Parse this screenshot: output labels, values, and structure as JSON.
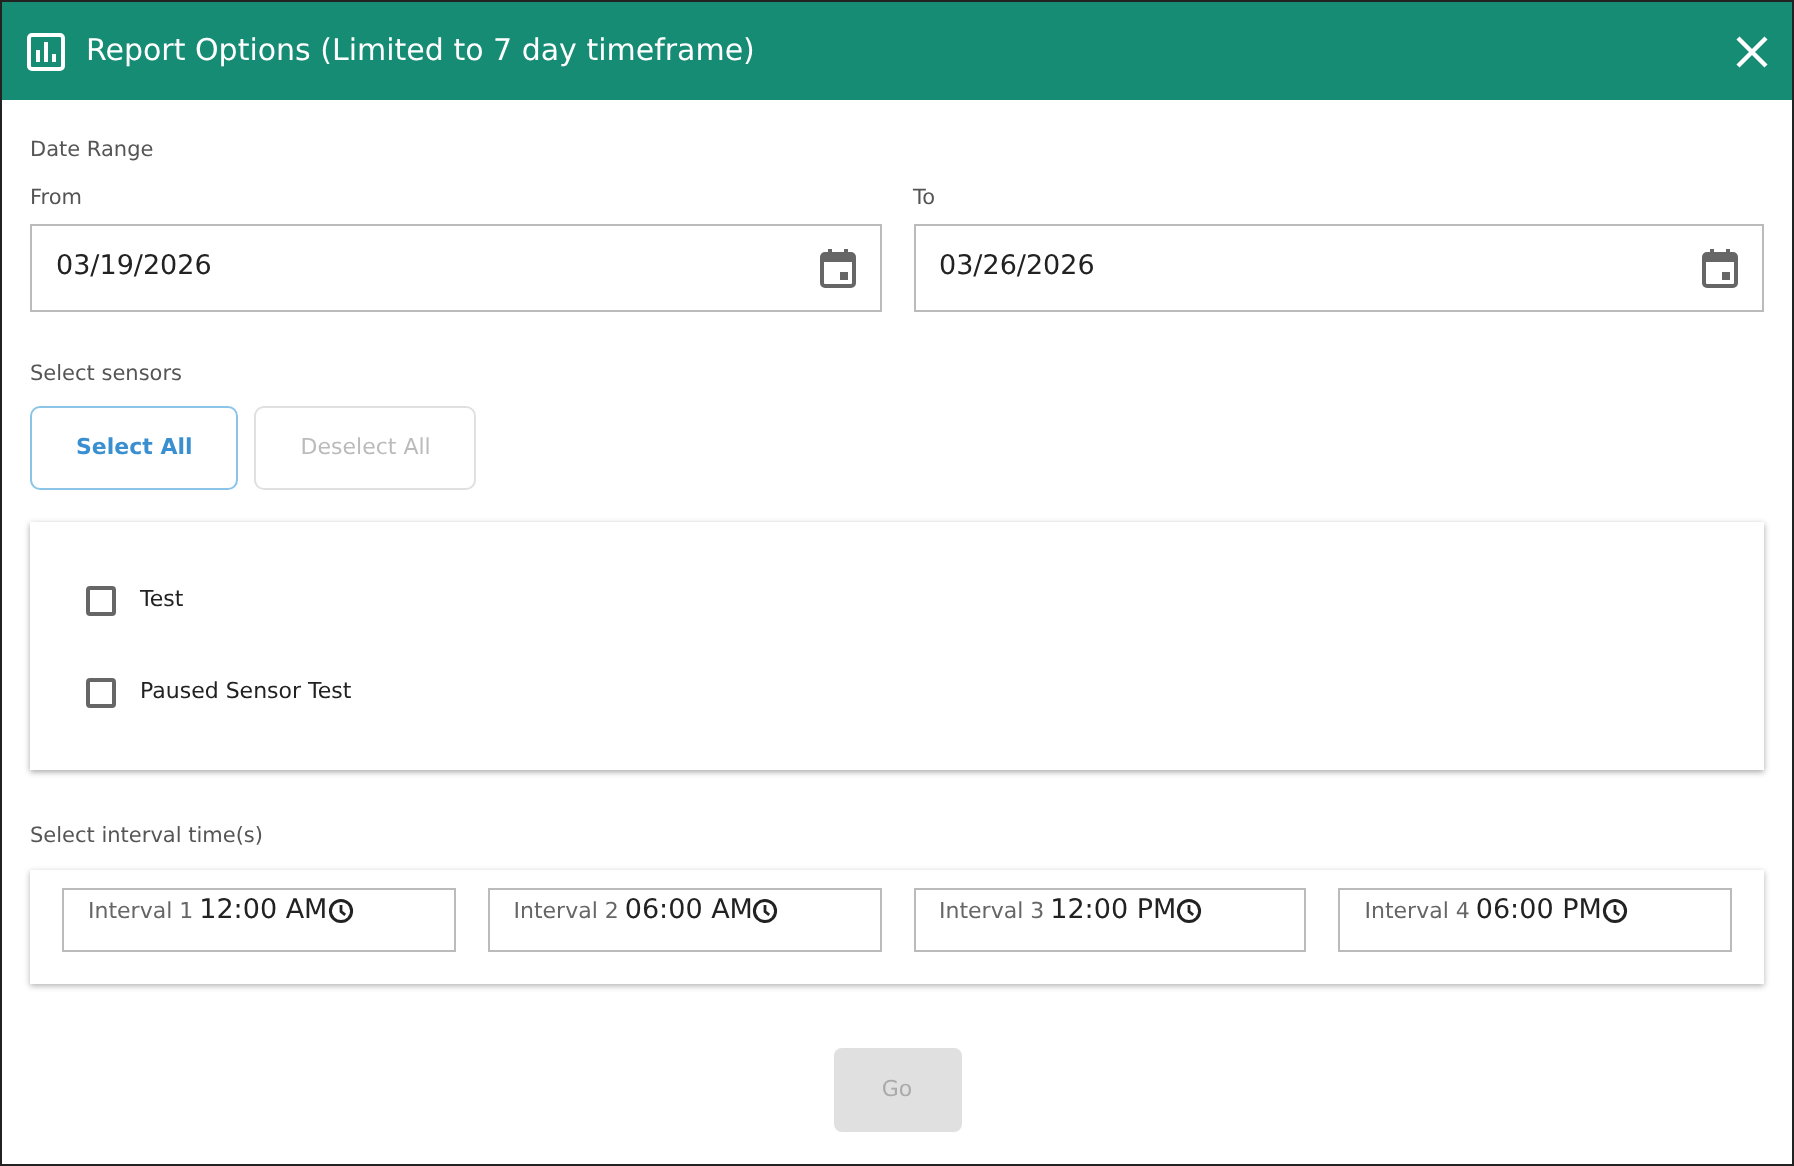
{
  "dialog": {
    "title": "Report Options (Limited to 7 day timeframe)"
  },
  "date_range": {
    "label": "Date Range",
    "fields": [
      {
        "label": "From",
        "value": "03/19/2026"
      },
      {
        "label": "To",
        "value": "03/26/2026"
      }
    ]
  },
  "sensors": {
    "label": "Select sensors",
    "buttons": [
      {
        "label": "Select All",
        "disabled": false
      },
      {
        "label": "Deselect All",
        "disabled": true
      }
    ],
    "items": [
      {
        "name": "Test",
        "checked": false
      },
      {
        "name": "Paused Sensor Test",
        "checked": false
      }
    ]
  },
  "intervals": {
    "label": "Select interval time(s)",
    "fields": [
      {
        "label": "Interval 1",
        "value": "12:00 AM"
      },
      {
        "label": "Interval 2",
        "value": "06:00 AM"
      },
      {
        "label": "Interval 3",
        "value": "12:00 PM"
      },
      {
        "label": "Interval 4",
        "value": "06:00 PM"
      }
    ]
  },
  "go_button": {
    "label": "Go",
    "disabled": true
  }
}
